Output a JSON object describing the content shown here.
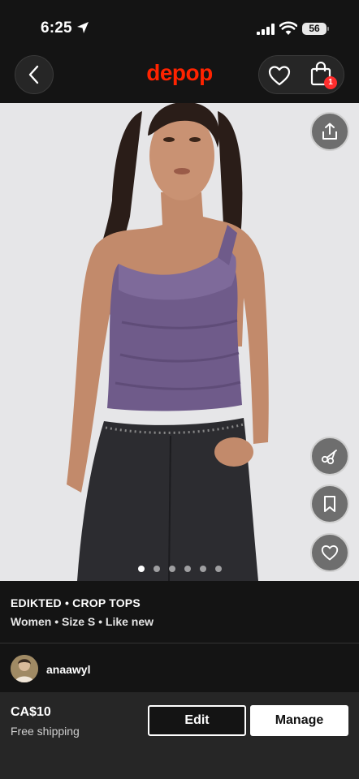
{
  "status_bar": {
    "time": "6:25",
    "battery": "56"
  },
  "nav": {
    "logo": "depop",
    "bag_count": "1"
  },
  "photo": {
    "icons": [
      "share-icon",
      "scissors-icon",
      "bookmark-icon",
      "heart-icon"
    ],
    "image_count": 6,
    "active_index": 0
  },
  "listing": {
    "brand_category": "EDIKTED • CROP TOPS",
    "meta": "Women • Size S • Like new"
  },
  "seller": {
    "username": "anaawyl"
  },
  "purchase": {
    "price": "CA$10",
    "shipping": "Free shipping",
    "edit_label": "Edit",
    "manage_label": "Manage"
  },
  "colors": {
    "brand": "#ff2300",
    "background": "#141414",
    "bottom_bar": "#262626",
    "badge": "#ff2d2d"
  }
}
